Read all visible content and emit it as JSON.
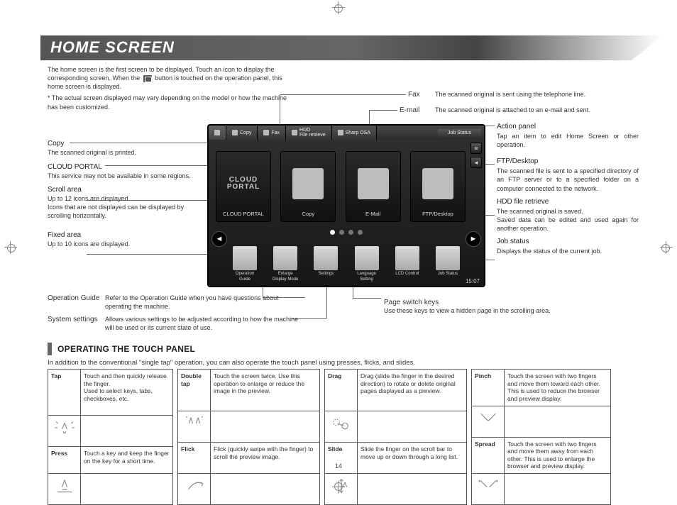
{
  "page": {
    "title": "HOME SCREEN",
    "intro_1": "The home screen is the first screen to be displayed. Touch an icon to display the corresponding screen. When the ",
    "intro_2": " button is touched on the operation panel, this home screen is displayed.",
    "intro_note": "* The actual screen displayed may vary depending on the model or how the machine has been customized.",
    "number": "14"
  },
  "callouts": {
    "fax": {
      "title": "Fax",
      "desc": "The scanned original is sent using the telephone line."
    },
    "email": {
      "title": "E-mail",
      "desc": "The scanned original is attached to an e-mail and sent."
    },
    "copy": {
      "title": "Copy",
      "desc": "The scanned original is printed."
    },
    "cloud": {
      "title": "CLOUD PORTAL",
      "desc": "This service may not be available in some regions."
    },
    "scroll": {
      "title": "Scroll area",
      "desc": "Up to 12 icons are displayed.\nIcons that are not displayed can be displayed by scrolling horizontally."
    },
    "fixed": {
      "title": "Fixed area",
      "desc": "Up to 10 icons are displayed."
    },
    "opguide": {
      "title": "Operation Guide",
      "desc": "Refer to the Operation Guide when you have questions about operating the machine."
    },
    "syssettings": {
      "title": "System settings",
      "desc": "Allows various settings to be adjusted according to how the machine will be used or its current state of use."
    },
    "actionpanel": {
      "title": "Action panel",
      "desc": "Tap an item to edit Home Screen or other operation."
    },
    "ftp": {
      "title": "FTP/Desktop",
      "desc": "The scanned file is sent to a specified directory of an FTP server or to a specified folder on a computer connected to the network."
    },
    "hdd": {
      "title": "HDD file retrieve",
      "desc": "The scanned original is saved.\nSaved data can be edited and used again for another operation."
    },
    "jobstatus": {
      "title": "Job status",
      "desc": "Displays the status of the current job."
    },
    "psk": {
      "title": "Page switch keys",
      "desc": "Use these keys to view a hidden page in the scrolling area."
    }
  },
  "panel": {
    "tabs": {
      "copy": "Copy",
      "fax": "Fax",
      "hdd": "HDD\nFile retrieve",
      "sharp": "Sharp OSA"
    },
    "job_status": "Job Status",
    "tiles": {
      "cloud1": "CLOUD",
      "cloud2": "PORTAL",
      "cloud_label": "CLOUD PORTAL",
      "copy": "Copy",
      "email": "E-Mail",
      "ftp": "FTP/Desktop"
    },
    "fixed": {
      "opguide1": "Operation",
      "opguide2": "Guide",
      "enlarge1": "Enlarge",
      "enlarge2": "Display Mode",
      "settings": "Settings",
      "lang1": "Language",
      "lang2": "Setting",
      "lcd": "LCD Control",
      "jobstatus": "Job Status"
    },
    "clock": "15:07",
    "arrows": {
      "left": "◄",
      "right": "►"
    }
  },
  "touch": {
    "heading": "OPERATING THE TOUCH PANEL",
    "intro": "In addition to the conventional \"single tap\" operation, you can also operate the touch panel using presses, flicks, and slides.",
    "tap": {
      "name": "Tap",
      "desc": "Touch and then quickly release the finger.\nUsed to select keys, tabs, checkboxes, etc."
    },
    "press": {
      "name": "Press",
      "desc": "Touch a key and keep the finger on the key for a short time."
    },
    "doubletap": {
      "name": "Double tap",
      "desc": "Touch the screen twice. Use this operation to enlarge or reduce the image in the preview."
    },
    "flick": {
      "name": "Flick",
      "desc": "Flick (quickly swipe with the finger) to scroll the preview image."
    },
    "drag": {
      "name": "Drag",
      "desc": "Drag (slide the finger in the desired direction) to rotate or delete original pages displayed as a preview."
    },
    "slide": {
      "name": "Slide",
      "desc": "Slide the finger on the scroll bar to move up or down through a long list."
    },
    "pinch": {
      "name": "Pinch",
      "desc": "Touch the screen with two fingers and move them toward each other. This is used to reduce the browser and preview display."
    },
    "spread": {
      "name": "Spread",
      "desc": "Touch the screen with two fingers and move them away from each other. This is used to enlarge the browser and preview display."
    }
  }
}
